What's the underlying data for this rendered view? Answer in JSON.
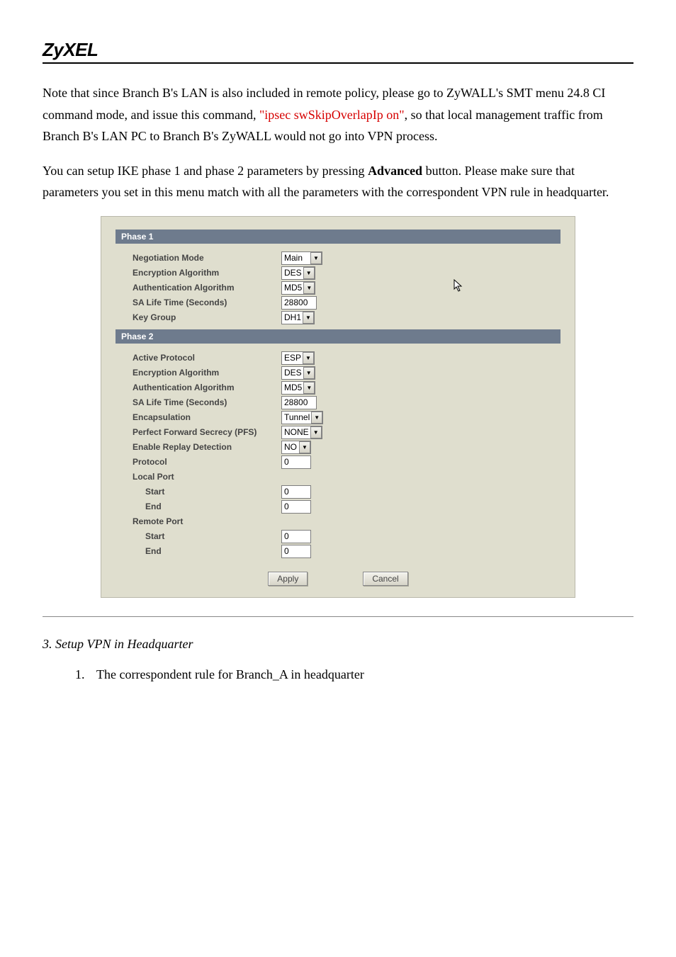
{
  "logo": "ZyXEL",
  "para1_part1": "Note that since Branch B's LAN is also included in remote policy, please go to ZyWALL's SMT menu 24.8 CI command mode, and issue this command, ",
  "para1_cmd": "\"ipsec swSkipOverlapIp on\"",
  "para1_part2": ", so that local management traffic from Branch B's LAN PC to Branch B's ZyWALL would not go into VPN process.",
  "para2_part1": "You can setup IKE phase 1 and phase 2 parameters by pressing ",
  "para2_bold": "Advanced",
  "para2_part2": " button. Please make sure that parameters you set in this menu match with all the parameters with the correspondent VPN rule in headquarter.",
  "phase1": {
    "title": "Phase 1",
    "negotiation_mode": {
      "label": "Negotiation Mode",
      "value": "Main"
    },
    "encryption_algorithm": {
      "label": "Encryption Algorithm",
      "value": "DES"
    },
    "authentication_algorithm": {
      "label": "Authentication Algorithm",
      "value": "MD5"
    },
    "sa_life_time": {
      "label": "SA Life Time (Seconds)",
      "value": "28800"
    },
    "key_group": {
      "label": "Key Group",
      "value": "DH1"
    }
  },
  "phase2": {
    "title": "Phase 2",
    "active_protocol": {
      "label": "Active Protocol",
      "value": "ESP"
    },
    "encryption_algorithm": {
      "label": "Encryption Algorithm",
      "value": "DES"
    },
    "authentication_algorithm": {
      "label": "Authentication Algorithm",
      "value": "MD5"
    },
    "sa_life_time": {
      "label": "SA Life Time (Seconds)",
      "value": "28800"
    },
    "encapsulation": {
      "label": "Encapsulation",
      "value": "Tunnel"
    },
    "pfs": {
      "label": "Perfect Forward Secrecy (PFS)",
      "value": "NONE"
    },
    "replay_detection": {
      "label": "Enable Replay Detection",
      "value": "NO"
    },
    "protocol": {
      "label": "Protocol",
      "value": "0"
    },
    "local_port": {
      "label": "Local Port"
    },
    "local_start": {
      "label": "Start",
      "value": "0"
    },
    "local_end": {
      "label": "End",
      "value": "0"
    },
    "remote_port": {
      "label": "Remote Port"
    },
    "remote_start": {
      "label": "Start",
      "value": "0"
    },
    "remote_end": {
      "label": "End",
      "value": "0"
    }
  },
  "buttons": {
    "apply": "Apply",
    "cancel": "Cancel"
  },
  "section3_title": "3. Setup VPN in Headquarter",
  "section3_item1_num": "1.",
  "section3_item1_text": "The correspondent rule for Branch_A in headquarter"
}
